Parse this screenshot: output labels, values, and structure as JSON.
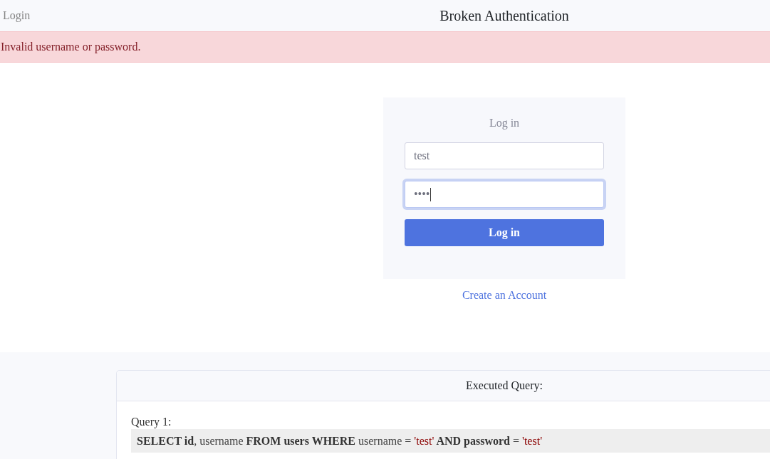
{
  "navbar": {
    "brand": "Login",
    "title": "Broken Authentication"
  },
  "alert": {
    "message": "Invalid username or password."
  },
  "login_form": {
    "heading": "Log in",
    "fields": [
      {
        "value": "test",
        "focused": false
      },
      {
        "value": "••••",
        "focused": true
      }
    ],
    "submit_button": "Log in"
  },
  "create_account_link": "Create an Account",
  "query_panel": {
    "header": "Executed Query:",
    "queries": [
      {
        "label": "Query 1:",
        "tokens": [
          {
            "kind": "keyword",
            "text": "SELECT id"
          },
          {
            "kind": "plain",
            "text": ", username "
          },
          {
            "kind": "keyword",
            "text": "FROM users WHERE"
          },
          {
            "kind": "plain",
            "text": " username = "
          },
          {
            "kind": "string",
            "text": "'test'"
          },
          {
            "kind": "keyword",
            "text": " AND password"
          },
          {
            "kind": "plain",
            "text": " = "
          },
          {
            "kind": "string",
            "text": "'test'"
          }
        ]
      }
    ]
  }
}
